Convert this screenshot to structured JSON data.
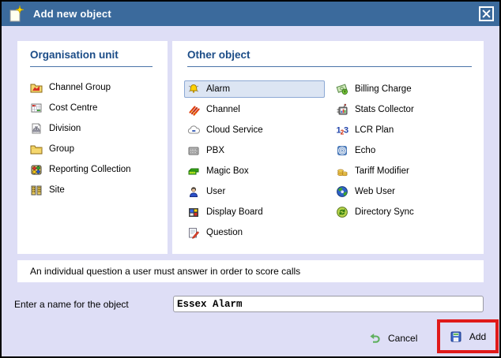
{
  "window": {
    "title": "Add new object",
    "icon": "new-object-icon"
  },
  "panels": {
    "organisation_unit": {
      "title": "Organisation unit",
      "items": [
        {
          "label": "Channel Group",
          "icon": "channel-group-icon"
        },
        {
          "label": "Cost Centre",
          "icon": "cost-centre-icon"
        },
        {
          "label": "Division",
          "icon": "division-icon"
        },
        {
          "label": "Group",
          "icon": "group-icon"
        },
        {
          "label": "Reporting Collection",
          "icon": "reporting-collection-icon"
        },
        {
          "label": "Site",
          "icon": "site-icon"
        }
      ]
    },
    "other_object": {
      "title": "Other object",
      "column1": [
        {
          "label": "Alarm",
          "icon": "alarm-icon",
          "selected": true
        },
        {
          "label": "Channel",
          "icon": "channel-icon",
          "selected": false
        },
        {
          "label": "Cloud Service",
          "icon": "cloud-service-icon",
          "selected": false
        },
        {
          "label": "PBX",
          "icon": "pbx-icon",
          "selected": false
        },
        {
          "label": "Magic Box",
          "icon": "magic-box-icon",
          "selected": false
        },
        {
          "label": "User",
          "icon": "user-icon",
          "selected": false
        },
        {
          "label": "Display Board",
          "icon": "display-board-icon",
          "selected": false
        },
        {
          "label": "Question",
          "icon": "question-icon",
          "selected": false
        }
      ],
      "column2": [
        {
          "label": "Billing Charge",
          "icon": "billing-charge-icon"
        },
        {
          "label": "Stats Collector",
          "icon": "stats-collector-icon"
        },
        {
          "label": "LCR Plan",
          "icon": "lcr-plan-icon"
        },
        {
          "label": "Echo",
          "icon": "echo-icon"
        },
        {
          "label": "Tariff Modifier",
          "icon": "tariff-modifier-icon"
        },
        {
          "label": "Web User",
          "icon": "web-user-icon"
        },
        {
          "label": "Directory Sync",
          "icon": "directory-sync-icon"
        }
      ]
    }
  },
  "description": "An individual question a user must answer in order to score calls",
  "name_field": {
    "label": "Enter a name for the object",
    "value": "Essex Alarm"
  },
  "actions": {
    "cancel_label": "Cancel",
    "add_label": "Add"
  },
  "colors": {
    "titlebar": "#3b6a9c",
    "body_background": "#dedef6",
    "panel_header_text": "#1b4c87",
    "selection_background": "#dce5f3",
    "selection_border": "#8ca9d4",
    "annotation_highlight": "#e01a1a"
  }
}
